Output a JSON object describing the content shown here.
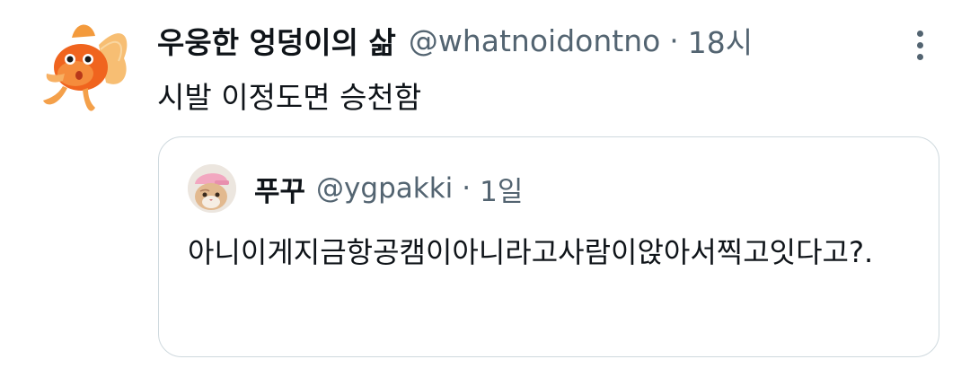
{
  "tweet": {
    "author": {
      "display_name": "우웅한 엉덩이의 삶",
      "handle": "@whatnoidontno",
      "avatar": "goldfish-avatar"
    },
    "separator": "·",
    "timestamp": "18시",
    "text": "시발 이정도면 승천함",
    "more_icon": "vertical-ellipsis-icon"
  },
  "quoted_tweet": {
    "author": {
      "display_name": "푸꾸",
      "handle": "@ygpakki",
      "avatar": "cat-avatar"
    },
    "separator": "·",
    "timestamp": "1일",
    "text": "아니이게지금항공캠이아니라고사람이앉아서찍고잇다고?."
  },
  "colors": {
    "text_primary": "#0f1419",
    "text_secondary": "#536471",
    "border": "#cfd9de"
  }
}
